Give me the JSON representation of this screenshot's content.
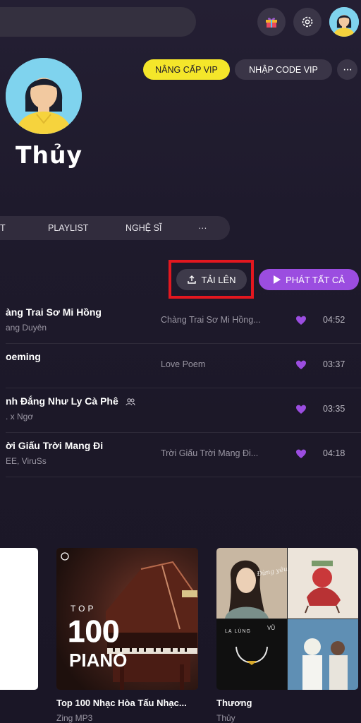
{
  "header": {
    "search_placeholder": "",
    "gift_icon": "gift-icon",
    "settings_icon": "gear-icon"
  },
  "profile": {
    "name": "Thủy",
    "vip_label": "NÂNG CẤP VIP",
    "code_label": "NHẬP CODE VIP",
    "more_label": "···"
  },
  "tabs": [
    {
      "label": "T"
    },
    {
      "label": "PLAYLIST"
    },
    {
      "label": "NGHỆ SĨ"
    },
    {
      "label": "···"
    }
  ],
  "actions": {
    "upload_label": "TẢI LÊN",
    "play_all_label": "PHÁT TẤT CẢ"
  },
  "songs": [
    {
      "title": "àng Trai Sơ Mi Hồng",
      "artist": "ang Duyên",
      "album": "Chàng Trai Sơ Mi Hồng...",
      "duration": "04:52"
    },
    {
      "title": "oeming",
      "artist": "",
      "album": "Love Poem",
      "duration": "03:37"
    },
    {
      "title": "nh Đắng Như Ly Cà Phê",
      "artist": ". x Ngơ",
      "album": "",
      "duration": "03:35"
    },
    {
      "title": "ời Giấu Trời Mang Đi",
      "artist": "EE, ViruSs",
      "album": "Trời Giấu Trời Mang Đi...",
      "duration": "04:18"
    }
  ],
  "cards": [
    {
      "title": "Top 100 Nhạc Hòa Tấu Nhạc...",
      "subtitle": "Zing MP3",
      "art_top": "TOP",
      "art_number": "100",
      "art_word": "PIANO"
    },
    {
      "title": "Thương",
      "subtitle": "Thủy",
      "art_text_1": "Đừng yêu nữa em mệt rồi",
      "art_text_2": "LẠ LÙNG",
      "art_text_3": "VŨ"
    }
  ],
  "colors": {
    "background": "#1c1828",
    "vip_yellow": "#f4e62a",
    "accent_purple": "#9b4de0",
    "highlight_red": "#e3171f"
  }
}
